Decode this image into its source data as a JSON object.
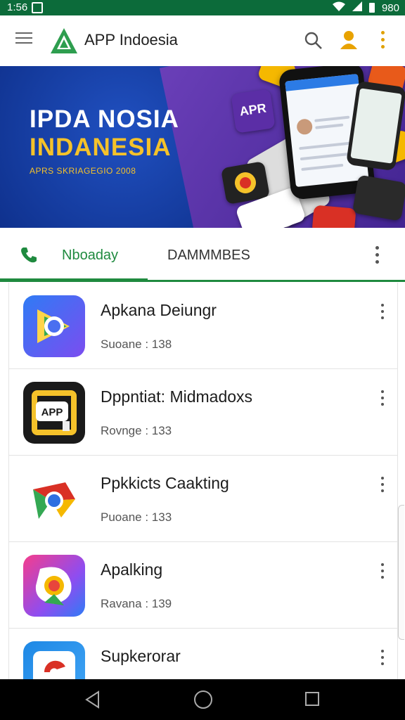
{
  "status_bar": {
    "time": "1:56",
    "battery": "980"
  },
  "app_bar": {
    "title": "APP Indoesia",
    "logo": "app-indonesia-logo",
    "icons": [
      "menu-icon",
      "search-icon",
      "person-icon",
      "overflow-icon"
    ]
  },
  "banner": {
    "title_line1": "IPDA NOSIA",
    "title_line2": "INDANESIA",
    "subtitle": "APRS SKRIAGEGIO 2008",
    "badge_text": "APR",
    "colors": {
      "title1": "#ffffff",
      "title2": "#f5c22a"
    }
  },
  "tabs": {
    "items": [
      {
        "label": "Nboaday",
        "icon": "phone-icon",
        "active": true
      },
      {
        "label": "DAMMMBES",
        "active": false
      }
    ],
    "accent": "#1f8a3f"
  },
  "apps": [
    {
      "name": "Apkana Deiungr",
      "meta": "Suoane : 138",
      "icon": "chrome-like-blue-icon"
    },
    {
      "name": "Dppntiat: Midmadoxs",
      "meta": "Rovnge : 133",
      "icon": "app-black-yellow-icon"
    },
    {
      "name": "Ppkkicts Caakting",
      "meta": "Puoane : 133",
      "icon": "chrome-icon"
    },
    {
      "name": "Apalking",
      "meta": "Ravana : 139",
      "icon": "colorful-camera-icon"
    },
    {
      "name": "Supkerorar",
      "meta": "",
      "icon": "blue-red-icon"
    }
  ]
}
